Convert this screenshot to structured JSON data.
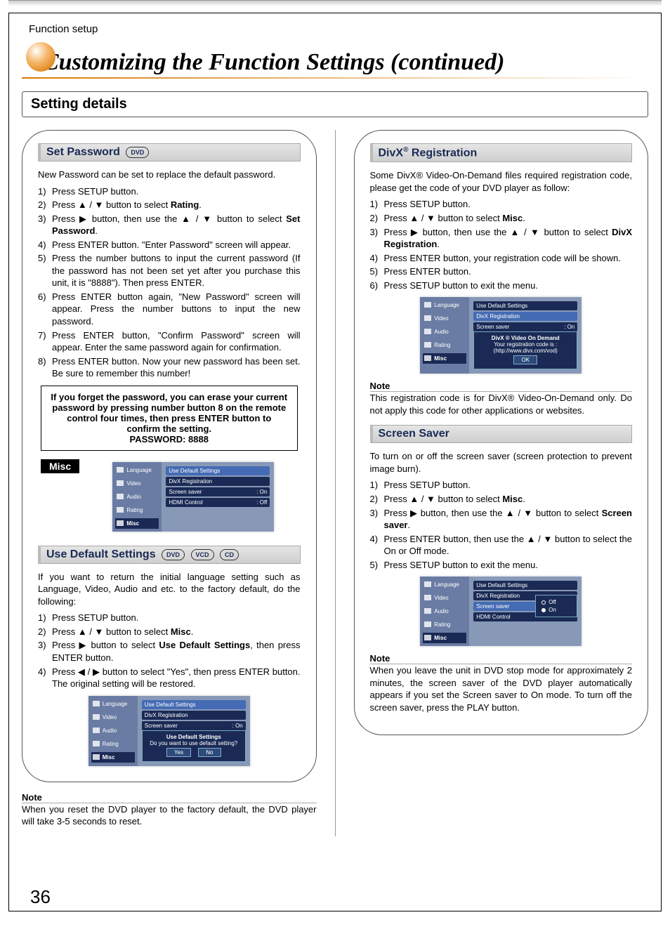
{
  "breadcrumb": "Function setup",
  "hero": "Customizing the Function Settings (continued)",
  "section_title": "Setting details",
  "page_num": "36",
  "badges": {
    "dvd": "DVD",
    "vcd": "VCD",
    "cd": "CD"
  },
  "misc_tag": "Misc",
  "ui_common": {
    "sidebar": [
      "Language",
      "Video",
      "Audio",
      "Rating",
      "Misc"
    ],
    "menu": {
      "use_default": "Use Default Settings",
      "divx_reg": "DivX Registration",
      "screen_saver": "Screen saver",
      "hdmi_control": "HDMI Control",
      "val_on": ": On",
      "val_off": ": Off",
      "off": "Off",
      "on": "On"
    }
  },
  "set_password": {
    "title": "Set Password",
    "intro": "New Password can be set to replace the default password.",
    "steps": [
      "Press SETUP button.",
      "Press ▲ / ▼ button to select <b>Rating</b>.",
      "Press ▶ button, then use the ▲ / ▼ button to select <b>Set Password</b>.",
      "Press ENTER button. \"Enter Password\" screen will appear.",
      "Press the number buttons to input the current password (If the password has not been set yet after you purchase this unit, it is \"8888\"). Then press ENTER.",
      "Press ENTER button again, \"New Password\" screen will appear. Press the number buttons to input the new password.",
      "Press ENTER button, \"Confirm Password\" screen will appear. Enter the same password again for confirmation.",
      "Press ENTER button. Now your new password has been set.  Be sure to remember this number!"
    ],
    "callout": "If you forget the password, you can erase your current password by pressing number button 8 on the remote control four times, then press ENTER button to confirm the setting.",
    "callout_pw": "PASSWORD: 8888"
  },
  "use_default": {
    "title": "Use Default Settings",
    "intro": "If you want to return the initial language setting such as Language, Video, Audio and etc. to the factory default, do the following:",
    "steps": [
      "Press SETUP button.",
      "Press ▲ / ▼ button to select <b>Misc</b>.",
      "Press ▶ button to select <b>Use Default Settings</b>, then press ENTER button.",
      "Press ◀ / ▶ button to select \"Yes\", then press ENTER button. The original setting will be restored."
    ],
    "dialog": {
      "title": "Use Default Settings",
      "text": "Do you want to use default setting?",
      "yes": "Yes",
      "no": "No"
    },
    "note_hdr": "Note",
    "note": "When you reset the DVD player to the factory default, the DVD player will take 3-5 seconds to reset."
  },
  "divx": {
    "title_pre": "DivX",
    "title_post": " Registration",
    "intro": "Some DivX® Video-On-Demand files required registration code, please get the code of your DVD player as follow:",
    "steps": [
      "Press SETUP button.",
      "Press ▲ / ▼ button to select <b>Misc</b>.",
      "Press ▶ button, then use the ▲ / ▼ button to select <b>DivX Registration</b>.",
      "Press ENTER button, your registration code will be shown.",
      "Press ENTER button.",
      "Press SETUP button to exit  the menu."
    ],
    "dialog": {
      "title": "DivX ® Video On Demand",
      "line1": "Your registration code is :",
      "line2": "(http://www.divx.com/vod)",
      "ok": "OK"
    },
    "note_hdr": "Note",
    "note": "This registration code is for DivX® Video-On-Demand only. Do not apply this code for other applications or websites."
  },
  "screensaver": {
    "title": "Screen Saver",
    "intro": "To turn on or off the screen saver (screen protection to prevent image burn).",
    "steps": [
      "Press SETUP button.",
      "Press ▲ / ▼ button to select <b>Misc</b>.",
      "Press ▶ button, then use the ▲ / ▼ button to select <b>Screen saver</b>.",
      "Press ENTER button, then use the ▲ / ▼ button to select the On or Off mode.",
      "Press SETUP button to exit the menu."
    ],
    "note_hdr": "Note",
    "note": "When you leave the unit in DVD stop mode for approximately 2 minutes, the screen saver of the DVD player automatically appears if you set the Screen saver to On mode. To turn off the screen saver, press the PLAY button."
  }
}
